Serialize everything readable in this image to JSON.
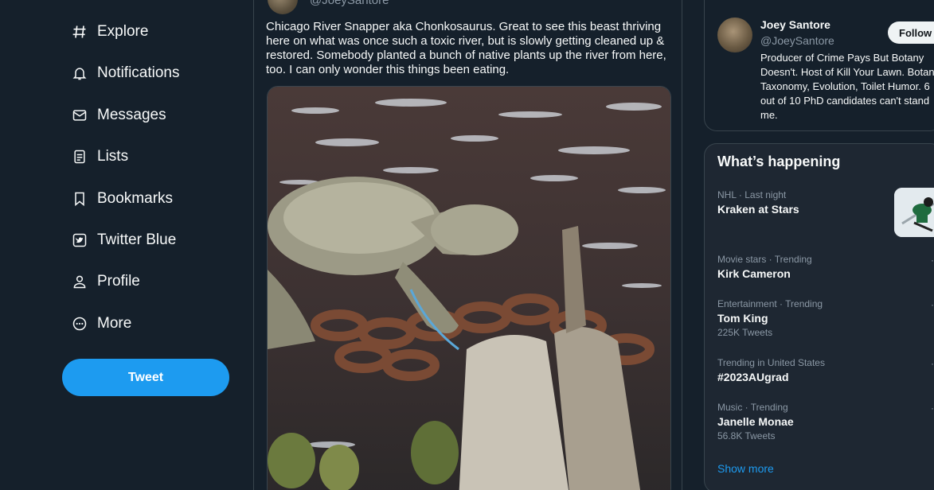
{
  "sidebar": {
    "items": [
      {
        "label": "Explore",
        "icon": "hashtag-icon"
      },
      {
        "label": "Notifications",
        "icon": "bell-icon"
      },
      {
        "label": "Messages",
        "icon": "envelope-icon"
      },
      {
        "label": "Lists",
        "icon": "list-icon"
      },
      {
        "label": "Bookmarks",
        "icon": "bookmark-icon"
      },
      {
        "label": "Twitter Blue",
        "icon": "twitter-blue-icon"
      },
      {
        "label": "Profile",
        "icon": "person-icon"
      },
      {
        "label": "More",
        "icon": "more-circle-icon"
      }
    ],
    "tweet_button": "Tweet"
  },
  "tweet": {
    "handle": "@JoeySantore",
    "text": "Chicago River Snapper aka Chonkosaurus. Great to see this beast thriving here on what was once such a toxic river, but is slowly getting cleaned up & restored. Somebody planted a bunch of native plants up the river from here, too. I can only wonder this things been eating."
  },
  "who_to_follow": {
    "name": "Joey Santore",
    "handle": "@JoeySantore",
    "follow_label": "Follow",
    "bio": "Producer of Crime Pays But Botany Doesn't. Host of Kill Your Lawn. Botany, Taxonomy, Evolution, Toilet Humor. 6 out of 10 PhD candidates can't stand me."
  },
  "trends": {
    "title": "What’s happening",
    "items": [
      {
        "meta": "NHL · Last night",
        "name": "Kraken at Stars",
        "count": ""
      },
      {
        "meta": "Movie stars · Trending",
        "name": "Kirk Cameron",
        "count": ""
      },
      {
        "meta": "Entertainment · Trending",
        "name": "Tom King",
        "count": "225K Tweets"
      },
      {
        "meta": "Trending in United States",
        "name": "#2023AUgrad",
        "count": ""
      },
      {
        "meta": "Music · Trending",
        "name": "Janelle Monae",
        "count": "56.8K Tweets"
      }
    ],
    "show_more": "Show more"
  },
  "colors": {
    "background": "#15202b",
    "accent": "#1d9bf0",
    "border": "#38444d",
    "muted_text": "#8b98a5"
  }
}
